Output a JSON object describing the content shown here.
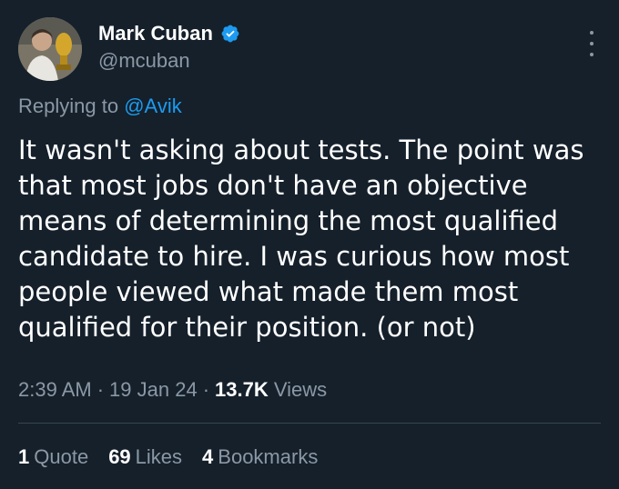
{
  "author": {
    "name": "Mark Cuban",
    "handle": "@mcuban",
    "verified": true,
    "verified_color": "#1d9bf0"
  },
  "reply": {
    "prefix": "Replying to",
    "to_handle": "@Avik"
  },
  "tweet": {
    "lines": [
      "It wasn't asking about tests. The point was",
      "that most jobs don't have an objective",
      "means of determining the most qualified",
      "candidate to hire.  I was curious how most",
      "people viewed what made them  most",
      "qualified for their position. (or not)"
    ]
  },
  "meta": {
    "time": "2:39 AM",
    "date": "19 Jan 24",
    "separator": "·",
    "views_count": "13.7K",
    "views_label": "Views"
  },
  "stats": {
    "quotes_count": "1",
    "quotes_label": "Quote",
    "likes_count": "69",
    "likes_label": "Likes",
    "bookmarks_count": "4",
    "bookmarks_label": "Bookmarks"
  },
  "icons": {
    "verified": "verified-badge-icon",
    "more": "more-options-icon"
  },
  "colors": {
    "background": "#15202b",
    "secondary_text": "#8b98a5",
    "link": "#1d9bf0",
    "divider": "#38444d"
  }
}
